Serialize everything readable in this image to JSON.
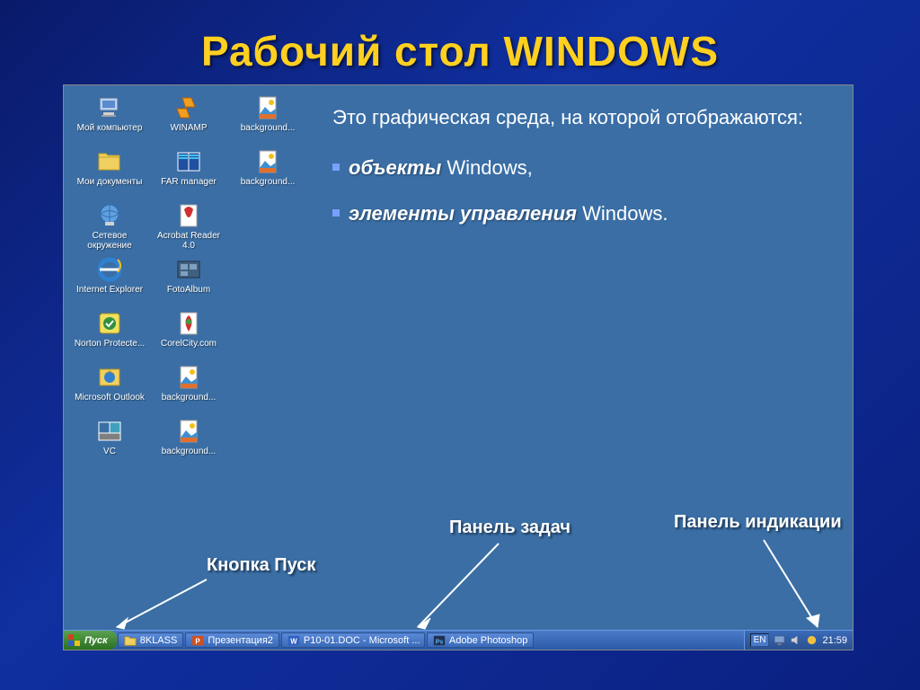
{
  "title": "Рабочий стол WINDOWS",
  "intro": "Это графическая среда, на которой отображаются:",
  "bullets": [
    {
      "em": "объекты",
      "rest": " Windows,"
    },
    {
      "em": "элементы управления",
      "rest": " Windows."
    }
  ],
  "desktop_icons": {
    "col1": [
      {
        "name": "my-computer-icon",
        "label": "Мой компьютер"
      },
      {
        "name": "my-documents-icon",
        "label": "Мои документы"
      },
      {
        "name": "network-places-icon",
        "label": "Сетевое окружение"
      },
      {
        "name": "internet-explorer-icon",
        "label": "Internet Explorer"
      },
      {
        "name": "norton-icon",
        "label": "Norton Protecte..."
      },
      {
        "name": "outlook-icon",
        "label": "Microsoft Outlook"
      },
      {
        "name": "vc-icon",
        "label": "VC"
      }
    ],
    "col2": [
      {
        "name": "winamp-icon",
        "label": "WINAMP"
      },
      {
        "name": "far-manager-icon",
        "label": "FAR manager"
      },
      {
        "name": "acrobat-reader-icon",
        "label": "Acrobat Reader 4.0"
      },
      {
        "name": "fotoalbum-icon",
        "label": "FotoAlbum"
      },
      {
        "name": "corelcity-icon",
        "label": "CorelCity.com"
      },
      {
        "name": "background-icon",
        "label": "background..."
      },
      {
        "name": "background-icon",
        "label": "background..."
      }
    ],
    "col3": [
      {
        "name": "background-icon",
        "label": "background..."
      },
      {
        "name": "background-icon",
        "label": "background..."
      }
    ]
  },
  "annotations": {
    "start_button": "Кнопка Пуск",
    "taskbar": "Панель задач",
    "tray": "Панель индикации"
  },
  "taskbar": {
    "start": "Пуск",
    "items": [
      {
        "icon": "folder-icon",
        "label": "8KLASS"
      },
      {
        "icon": "powerpoint-icon",
        "label": "Презентация2"
      },
      {
        "icon": "word-icon",
        "label": "P10-01.DOC - Microsoft ..."
      },
      {
        "icon": "photoshop-icon",
        "label": "Adobe Photoshop"
      }
    ],
    "lang": "EN",
    "clock": "21:59"
  }
}
